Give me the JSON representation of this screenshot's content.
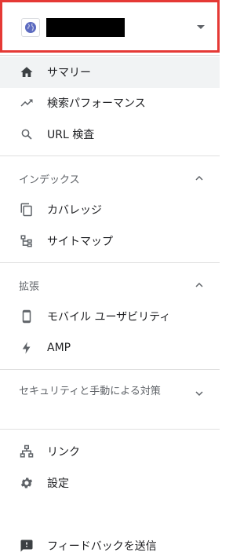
{
  "property": {
    "name": ""
  },
  "nav": {
    "summary": "サマリー",
    "performance": "検索パフォーマンス",
    "url_inspection": "URL 検査",
    "index_section": "インデックス",
    "coverage": "カバレッジ",
    "sitemaps": "サイトマップ",
    "enhancements_section": "拡張",
    "mobile_usability": "モバイル ユーザビリティ",
    "amp": "AMP",
    "security_section": "セキュリティと手動による対策",
    "links": "リンク",
    "settings": "設定",
    "feedback": "フィードバックを送信"
  },
  "colors": {
    "highlight_border": "#e53935",
    "active_background": "#f1f3f4",
    "icon": "#5f6368",
    "active_icon": "#3c4043"
  }
}
